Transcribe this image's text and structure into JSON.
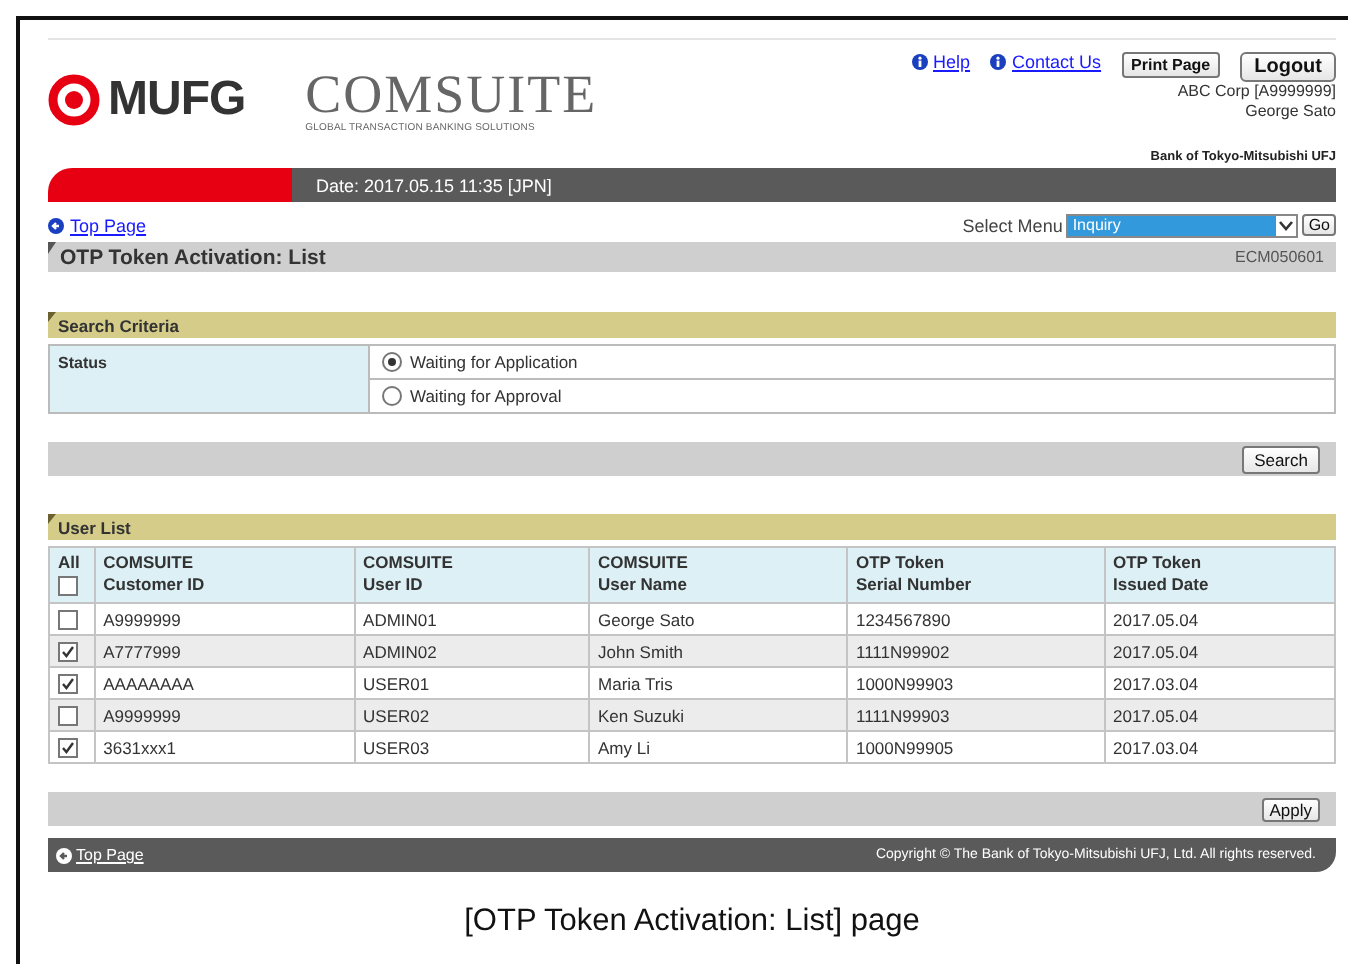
{
  "header": {
    "logo_text": "MUFG",
    "brand": "COMSUITE",
    "tagline": "GLOBAL TRANSACTION BANKING SOLUTIONS",
    "links": [
      "Help",
      "Contact Us"
    ],
    "print_button": "Print Page",
    "logout_button": "Logout",
    "company": "ABC Corp [A9999999]",
    "user": "George Sato",
    "bank": "Bank of Tokyo-Mitsubishi UFJ"
  },
  "date_bar": "Date: 2017.05.15 11:35 [JPN]",
  "nav": {
    "top_link": "Top Page",
    "select_label": "Select Menu",
    "select_value": "Inquiry",
    "go_button": "Go"
  },
  "page_title": "OTP Token Activation: List",
  "screen_id": "ECM050601",
  "search_criteria": {
    "title": "Search Criteria",
    "field_label": "Status",
    "options": [
      {
        "label": "Waiting for Application",
        "selected": true
      },
      {
        "label": "Waiting for Approval",
        "selected": false
      }
    ],
    "button": "Search"
  },
  "user_list": {
    "title": "User List",
    "all_label": "All",
    "all_checked": false,
    "columns": [
      {
        "group": "COMSUITE",
        "name": "Customer ID"
      },
      {
        "group": "COMSUITE",
        "name": "User ID"
      },
      {
        "group": "COMSUITE",
        "name": "User Name"
      },
      {
        "group": "OTP Token",
        "name": "Serial Number"
      },
      {
        "group": "OTP Token",
        "name": "Issued Date"
      }
    ],
    "rows": [
      {
        "checked": false,
        "cells": [
          "A9999999",
          "ADMIN01",
          "George Sato",
          "1234567890",
          "2017.05.04"
        ]
      },
      {
        "checked": true,
        "cells": [
          "A7777999",
          "ADMIN02",
          "John Smith",
          "1111N99902",
          "2017.05.04"
        ]
      },
      {
        "checked": true,
        "cells": [
          "AAAAAAAA",
          "USER01",
          "Maria Tris",
          "1000N99903",
          "2017.03.04"
        ]
      },
      {
        "checked": false,
        "cells": [
          "A9999999",
          "USER02",
          "Ken Suzuki",
          "1111N99903",
          "2017.05.04"
        ]
      },
      {
        "checked": true,
        "cells": [
          "3631xxx1",
          "USER03",
          "Amy Li",
          "1000N99905",
          "2017.03.04"
        ]
      }
    ],
    "button": "Apply"
  },
  "footer": {
    "top_link": "Top Page",
    "copyright": "Copyright © The Bank of Tokyo-Mitsubishi UFJ, Ltd. All rights reserved."
  },
  "caption": "[OTP Token Activation: List] page"
}
